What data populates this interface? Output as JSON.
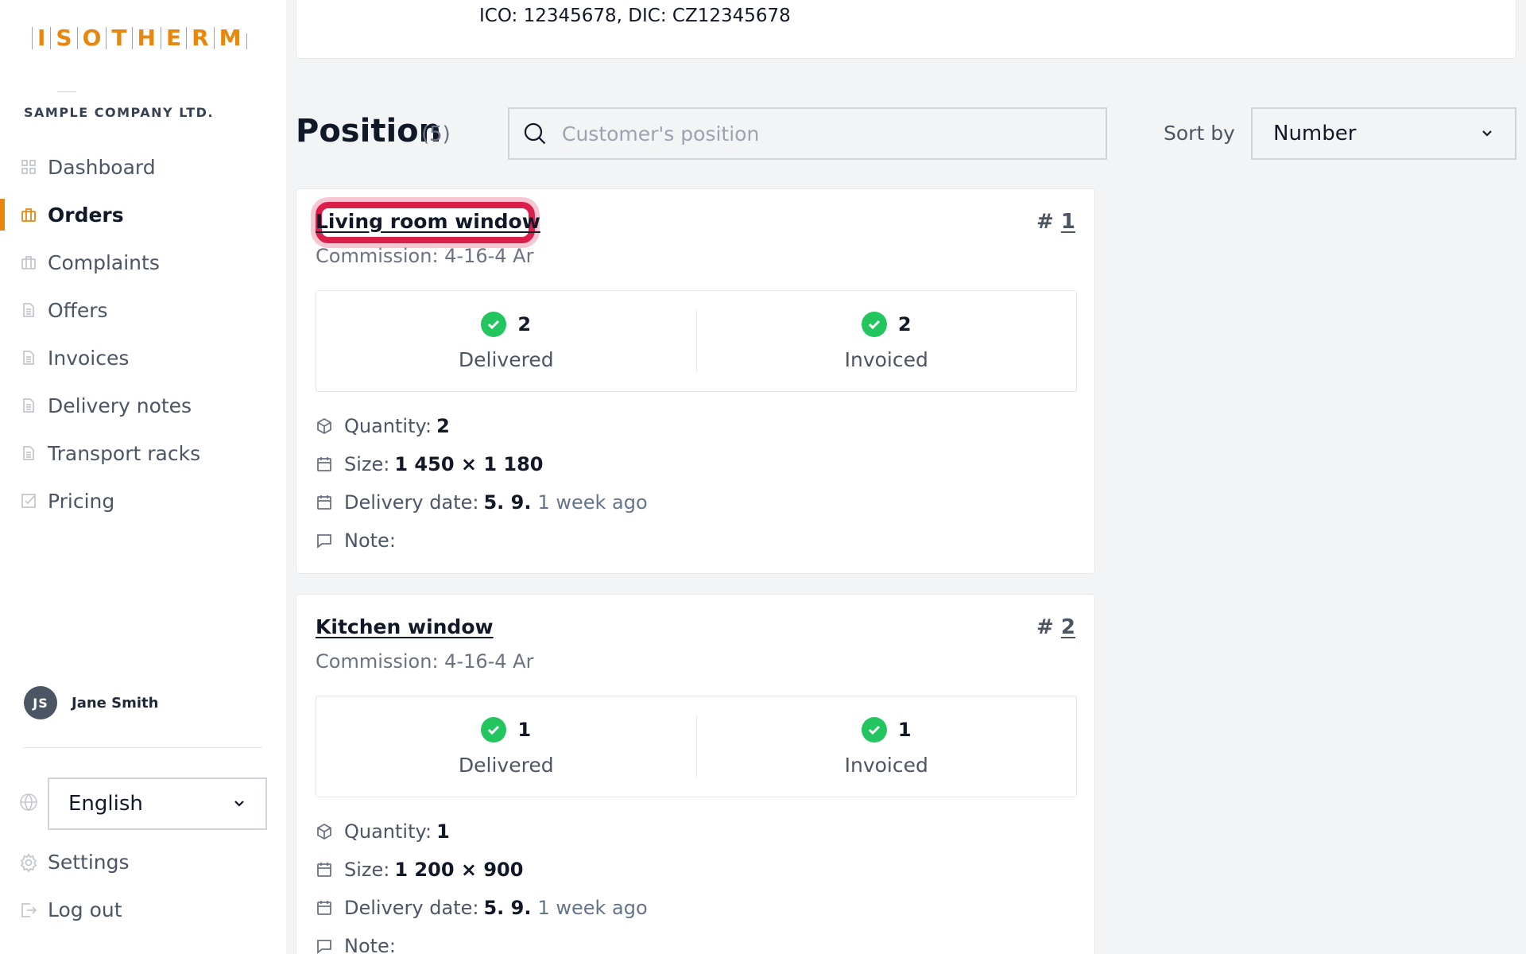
{
  "logo": {
    "letters": [
      "I",
      "S",
      "O",
      "T",
      "H",
      "E",
      "R",
      "M"
    ]
  },
  "company": "SAMPLE COMPANY LTD.",
  "nav": [
    {
      "label": "Dashboard",
      "icon": "grid-icon"
    },
    {
      "label": "Orders",
      "icon": "briefcase-icon",
      "active": true
    },
    {
      "label": "Complaints",
      "icon": "briefcase-icon"
    },
    {
      "label": "Offers",
      "icon": "document-icon"
    },
    {
      "label": "Invoices",
      "icon": "document-icon"
    },
    {
      "label": "Delivery notes",
      "icon": "document-icon"
    },
    {
      "label": "Transport racks",
      "icon": "document-icon"
    },
    {
      "label": "Pricing",
      "icon": "checkbox-icon"
    }
  ],
  "user": {
    "initials": "JS",
    "name": "Jane Smith"
  },
  "language": {
    "selected": "English"
  },
  "bottom": {
    "settings": "Settings",
    "logout": "Log out"
  },
  "header": {
    "ids": "ICO: 12345678, DIC: CZ12345678"
  },
  "positions": {
    "title": "Position",
    "count": "(5)",
    "search_placeholder": "Customer's position",
    "sort_label": "Sort by",
    "sort_selected": "Number"
  },
  "cards": [
    {
      "title": "Living room window",
      "hash": "#",
      "number": "1",
      "commission": "Commission: 4-16-4 Ar",
      "delivered_count": "2",
      "delivered_label": "Delivered",
      "invoiced_count": "2",
      "invoiced_label": "Invoiced",
      "quantity_label": "Quantity:",
      "quantity": "2",
      "size_label": "Size:",
      "size": "1 450 × 1 180",
      "delivery_label": "Delivery date:",
      "delivery_date": "5. 9.",
      "delivery_relative": "1 week ago",
      "note_label": "Note:"
    },
    {
      "title": "Kitchen window",
      "hash": "#",
      "number": "2",
      "commission": "Commission: 4-16-4 Ar",
      "delivered_count": "1",
      "delivered_label": "Delivered",
      "invoiced_count": "1",
      "invoiced_label": "Invoiced",
      "quantity_label": "Quantity:",
      "quantity": "1",
      "size_label": "Size:",
      "size": "1 200 × 900",
      "delivery_label": "Delivery date:",
      "delivery_date": "5. 9.",
      "delivery_relative": "1 week ago",
      "note_label": "Note:"
    }
  ],
  "colors": {
    "accent": "#e8870e",
    "success": "#22c55e",
    "highlight": "#dc1e4b"
  }
}
